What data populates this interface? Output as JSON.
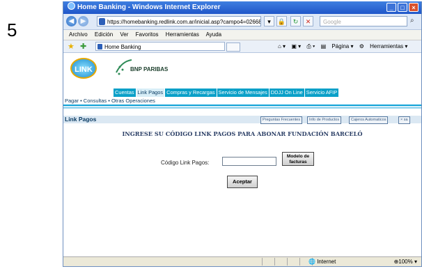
{
  "step": "5",
  "window": {
    "title": "Home Banking - Windows Internet Explorer",
    "url": "https://homebanking.redlink.com.ar/inicial.asp?campo4=02668campo5=",
    "search_placeholder": "Google",
    "menu": [
      "Archivo",
      "Edición",
      "Ver",
      "Favoritos",
      "Herramientas",
      "Ayuda"
    ],
    "tab_label": "Home Banking",
    "toolbar": [
      "Página",
      "Herramientas"
    ]
  },
  "brand": {
    "link_logo": "LINK",
    "bank_name": "BNP PARIBAS"
  },
  "nav_tabs": [
    "Cuentas",
    "Link Pagos",
    "Compras y Recargas",
    "Servicio de Mensajes",
    "DDJJ On Line",
    "Servicio AFIP"
  ],
  "active_tab": "Link Pagos",
  "subnav": "Pagar  •  Consultas  •  Otras Operaciones",
  "page": {
    "heading": "Link Pagos",
    "header_buttons": [
      "Preguntas Frecuentes",
      "Info de Productos",
      "Cajeros Automaticos",
      "× sa"
    ],
    "title": "INGRESE SU CÓDIGO LINK PAGOS PARA ABONAR FUNDACIÓN BARCELÓ",
    "code_label": "Código Link Pagos:",
    "modelo_button": "Modelo de facturas",
    "aceptar_button": "Aceptar"
  },
  "status": {
    "zone": "Internet",
    "zoom": "100%"
  },
  "colors": {
    "tab_bg": "#0aa0c8",
    "accent": "#0a9fd6"
  }
}
